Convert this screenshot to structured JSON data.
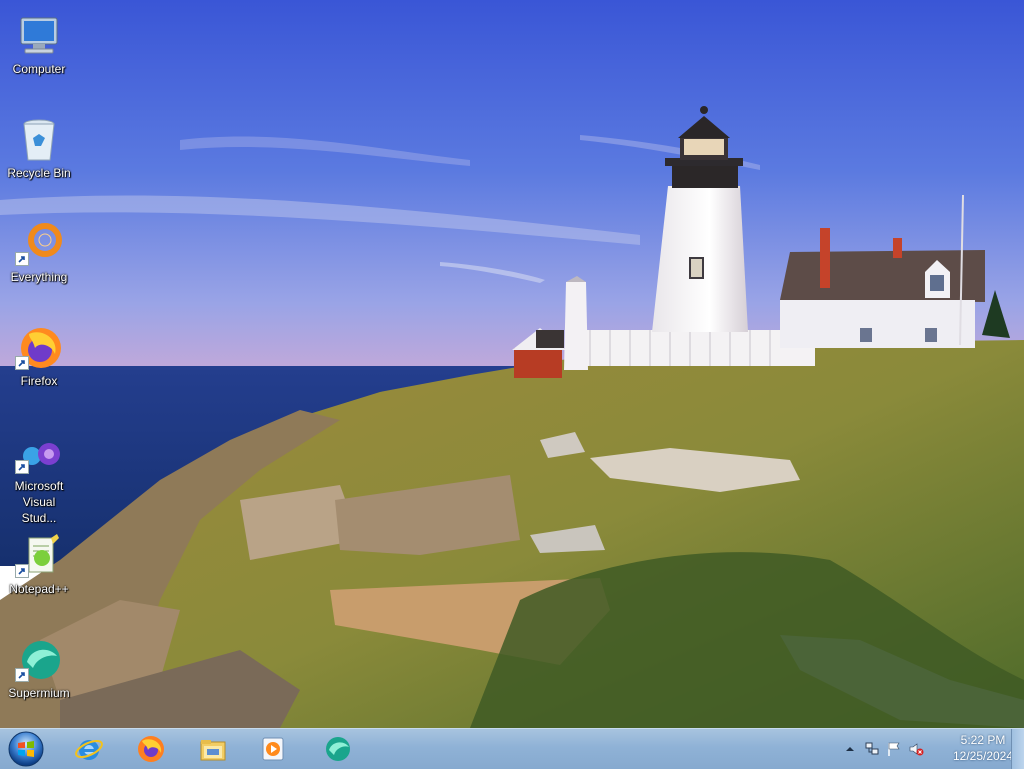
{
  "desktop": {
    "icons": [
      {
        "label": "Computer",
        "icon": "computer-icon",
        "shortcut": false
      },
      {
        "label": "Recycle Bin",
        "icon": "recycle-bin-icon",
        "shortcut": false
      },
      {
        "label": "Everything",
        "icon": "everything-icon",
        "shortcut": true
      },
      {
        "label": "Firefox",
        "icon": "firefox-icon",
        "shortcut": true
      },
      {
        "label": "Microsoft Visual Stud...",
        "icon": "visual-studio-icon",
        "shortcut": true
      },
      {
        "label": "Notepad++",
        "icon": "notepad-plus-plus-icon",
        "shortcut": true
      },
      {
        "label": "Supermium",
        "icon": "supermium-icon",
        "shortcut": true
      }
    ]
  },
  "taskbar": {
    "pinned": [
      {
        "name": "internet-explorer-icon"
      },
      {
        "name": "firefox-icon"
      },
      {
        "name": "file-explorer-icon"
      },
      {
        "name": "media-player-icon"
      },
      {
        "name": "supermium-icon"
      }
    ],
    "tray": {
      "time": "5:22 PM",
      "date": "12/25/2024",
      "icons": [
        "show-hidden-icons",
        "network-icon",
        "action-center-flag-icon",
        "volume-muted-icon"
      ]
    }
  },
  "colors": {
    "taskbar": "#8fb2d6",
    "sky_top": "#3b5ed8",
    "sea": "#1e3c8a"
  }
}
